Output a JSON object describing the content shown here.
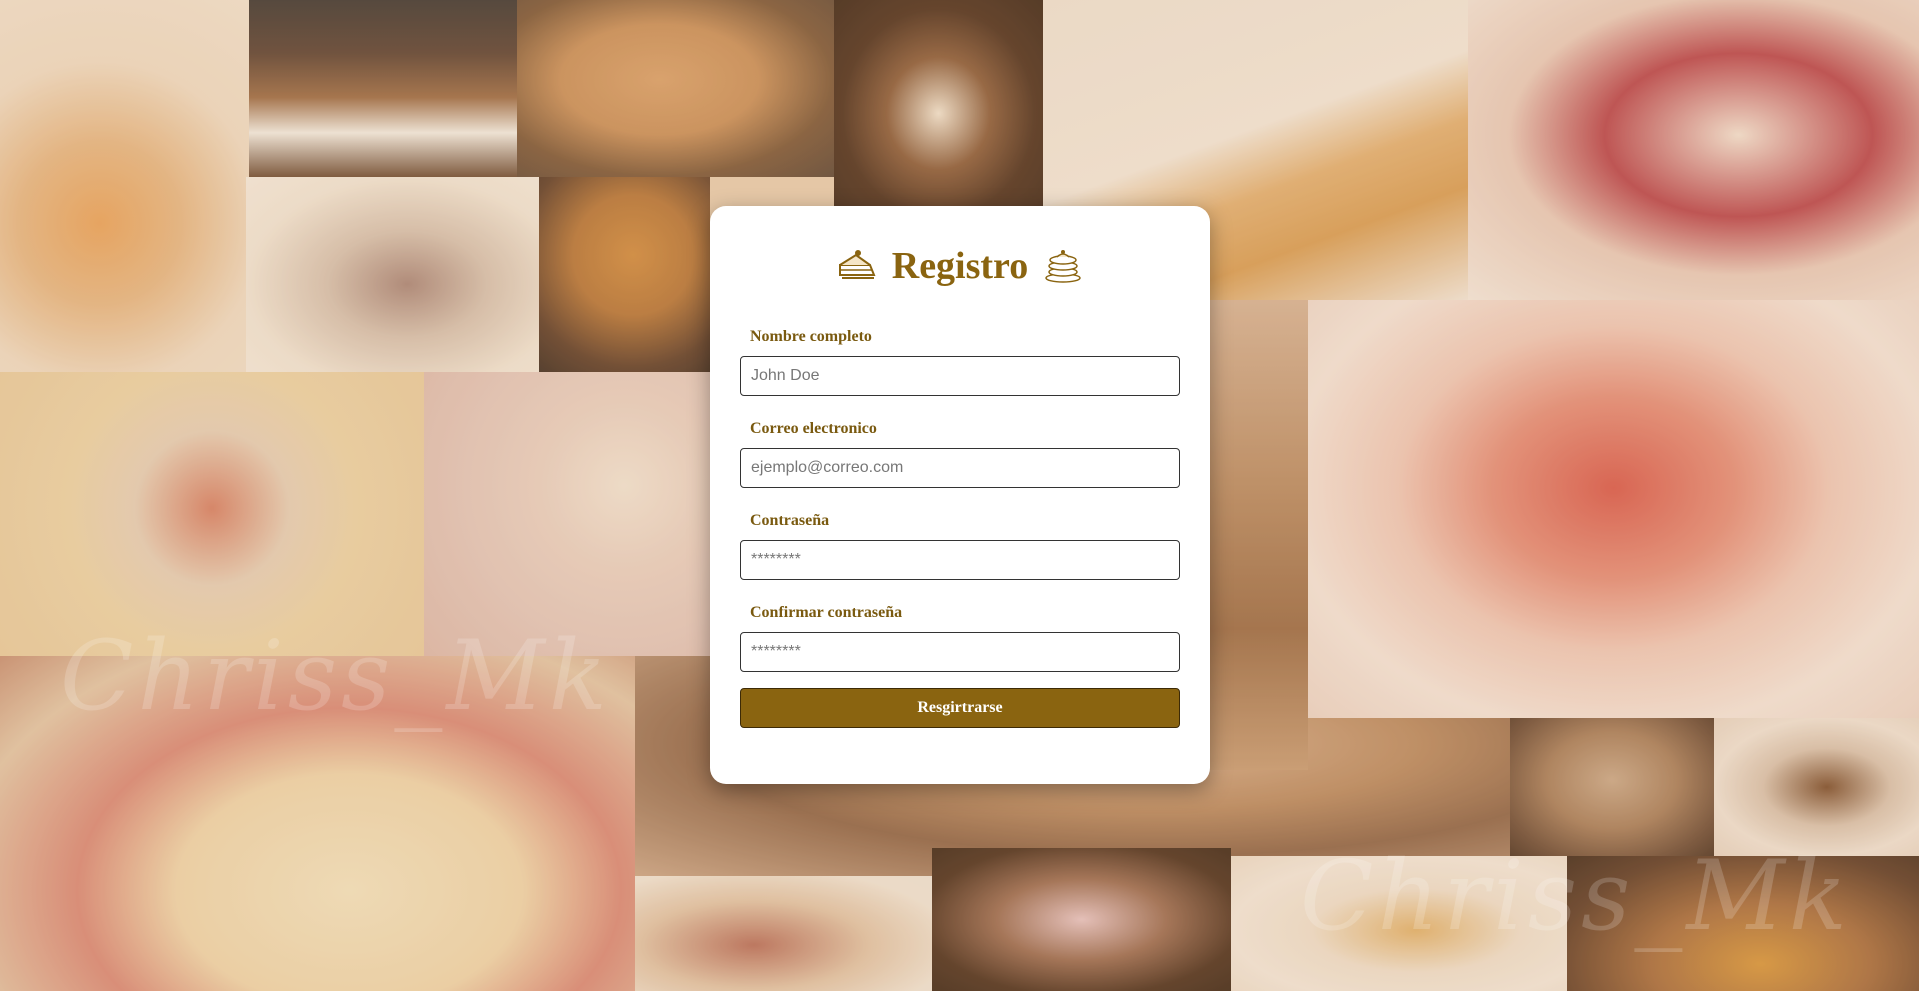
{
  "form": {
    "title": "Registro",
    "title_icon_left": "cake-slice-icon",
    "title_icon_right": "pancake-stack-icon",
    "fields": [
      {
        "label": "Nombre completo",
        "placeholder": "John Doe",
        "type": "text"
      },
      {
        "label": "Correo electronico",
        "placeholder": "ejemplo@correo.com",
        "type": "email"
      },
      {
        "label": "Contraseña",
        "placeholder": "********",
        "type": "password"
      },
      {
        "label": "Confirmar contraseña",
        "placeholder": "********",
        "type": "password"
      }
    ],
    "submit_label": "Resgirtrarse"
  },
  "colors": {
    "accent": "#8a6410",
    "label": "#7a5a10",
    "card": "#ffffff"
  }
}
